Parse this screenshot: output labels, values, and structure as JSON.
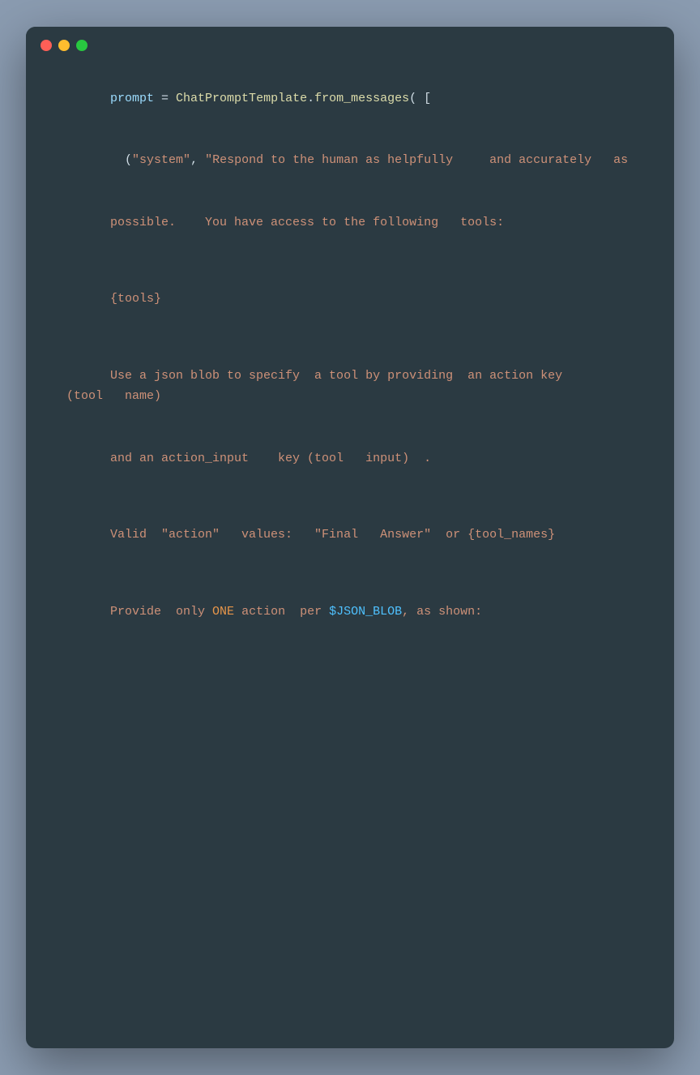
{
  "window": {
    "dots": [
      "red",
      "yellow",
      "green"
    ]
  },
  "code": {
    "lines": [
      {
        "id": "line1",
        "type": "code"
      },
      {
        "id": "line2",
        "type": "code"
      },
      {
        "id": "line3",
        "type": "code"
      },
      {
        "id": "line4",
        "type": "code"
      },
      {
        "id": "blank1",
        "type": "blank"
      },
      {
        "id": "line5",
        "type": "code"
      },
      {
        "id": "blank2",
        "type": "blank"
      },
      {
        "id": "line6",
        "type": "code"
      },
      {
        "id": "line7",
        "type": "code"
      },
      {
        "id": "blank3",
        "type": "blank"
      },
      {
        "id": "line8",
        "type": "code"
      },
      {
        "id": "blank4",
        "type": "blank"
      },
      {
        "id": "line9",
        "type": "code"
      },
      {
        "id": "blank5",
        "type": "blank"
      },
      {
        "id": "line10",
        "type": "code"
      },
      {
        "id": "line11",
        "type": "code"
      },
      {
        "id": "line12",
        "type": "code"
      },
      {
        "id": "line13",
        "type": "code"
      },
      {
        "id": "line14",
        "type": "code"
      },
      {
        "id": "line15",
        "type": "code"
      },
      {
        "id": "blank6",
        "type": "blank"
      },
      {
        "id": "line16",
        "type": "code"
      },
      {
        "id": "blank7",
        "type": "blank"
      },
      {
        "id": "line17",
        "type": "code"
      },
      {
        "id": "line18",
        "type": "code"
      },
      {
        "id": "line19",
        "type": "code"
      },
      {
        "id": "line20",
        "type": "code"
      },
      {
        "id": "line21",
        "type": "code"
      },
      {
        "id": "line22",
        "type": "code"
      },
      {
        "id": "line23",
        "type": "code"
      },
      {
        "id": "line24",
        "type": "code"
      },
      {
        "id": "line25",
        "type": "code"
      },
      {
        "id": "line26",
        "type": "code"
      },
      {
        "id": "line27",
        "type": "code"
      },
      {
        "id": "line28",
        "type": "code"
      },
      {
        "id": "line29",
        "type": "code"
      },
      {
        "id": "line30",
        "type": "code"
      },
      {
        "id": "line31",
        "type": "code"
      },
      {
        "id": "line32",
        "type": "code"
      },
      {
        "id": "line33",
        "type": "code"
      },
      {
        "id": "line34",
        "type": "code"
      },
      {
        "id": "line35",
        "type": "code"
      },
      {
        "id": "blank8",
        "type": "blank"
      },
      {
        "id": "line36",
        "type": "code"
      },
      {
        "id": "line37",
        "type": "code"
      },
      {
        "id": "line38",
        "type": "code"
      },
      {
        "id": "line39",
        "type": "code"
      },
      {
        "id": "blank9",
        "type": "blank"
      },
      {
        "id": "line40",
        "type": "code"
      },
      {
        "id": "line41",
        "type": "code"
      },
      {
        "id": "line42",
        "type": "code"
      },
      {
        "id": "line43",
        "type": "code"
      }
    ]
  }
}
